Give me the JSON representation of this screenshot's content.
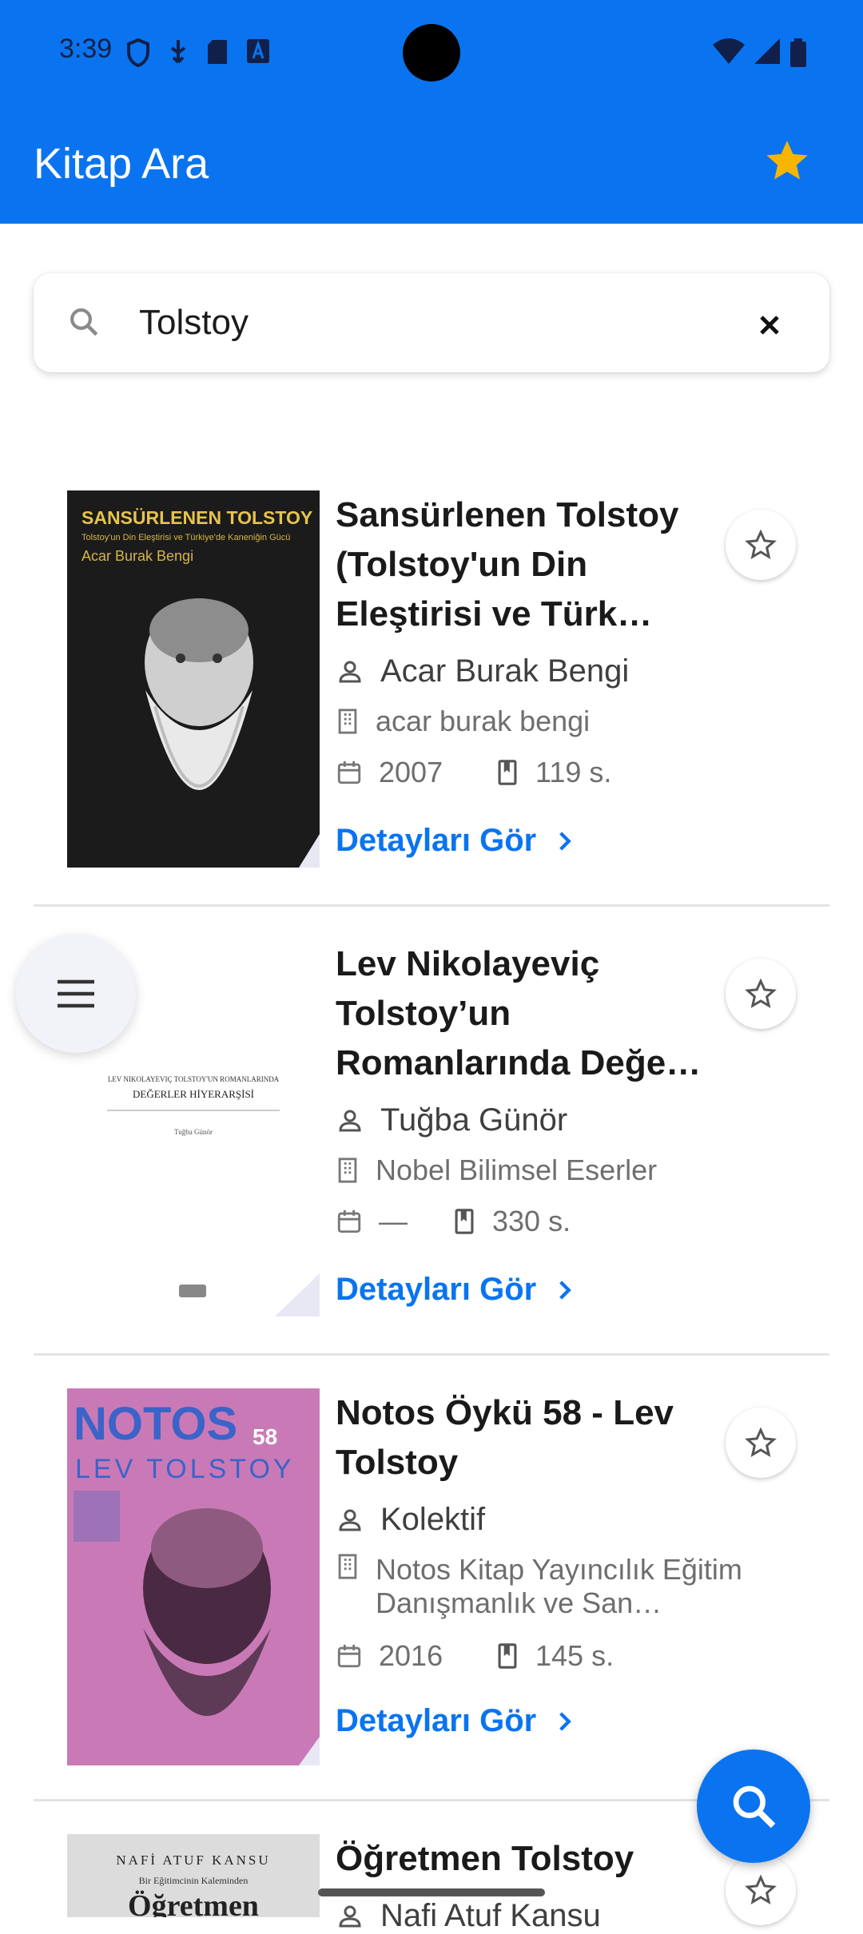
{
  "status_bar": {
    "time": "3:39"
  },
  "app_bar": {
    "title": "Kitap Ara"
  },
  "search": {
    "query": "Tolstoy"
  },
  "books": [
    {
      "title": "Sansürlenen Tolstoy (Tolstoy'un Din Eleştirisi ve Türk…",
      "author": "Acar Burak Bengi",
      "publisher": "acar burak bengi",
      "year": "2007",
      "pages": "119 s.",
      "details_label": "Detayları Gör",
      "cover_title": "SANSÜRLENEN TOLSTOY",
      "cover_subtitle": "Tolstoy'un Din Eleştirisi ve Türkiye'de Kaneniğin Gücü",
      "cover_author": "Acar Burak Bengi"
    },
    {
      "title": "Lev Nikolayeviç Tolstoy’un Romanlarında Değe…",
      "author": "Tuğba Günör",
      "publisher": "Nobel Bilimsel Eserler",
      "year": "—",
      "pages": "330 s.",
      "details_label": "Detayları Gör",
      "cover_title": "LEV NIKOLAYEVIÇ TOLSTOY'UN ROMANLARINDA",
      "cover_subtitle": "DEĞERLER HİYERARŞİSİ",
      "cover_author": "Tuğba Günör"
    },
    {
      "title": "Notos Öykü 58 - Lev Tolstoy",
      "author": "Kolektif",
      "publisher": "Notos Kitap Yayıncılık Eğitim Danışmanlık ve San…",
      "year": "2016",
      "pages": "145 s.",
      "details_label": "Detayları Gör",
      "cover_title": "NOTOS",
      "cover_number": "58",
      "cover_subtitle": "LEV TOLSTOY"
    },
    {
      "title": "Öğretmen Tolstoy",
      "author": "Nafi Atuf Kansu",
      "cover_author": "NAFİ ATUF KANSU",
      "cover_subtitle": "Bir Eğitimcinin Kaleminden",
      "cover_title": "Öğretmen"
    }
  ],
  "colors": {
    "primary": "#0a74f0",
    "star": "#f7b500"
  }
}
